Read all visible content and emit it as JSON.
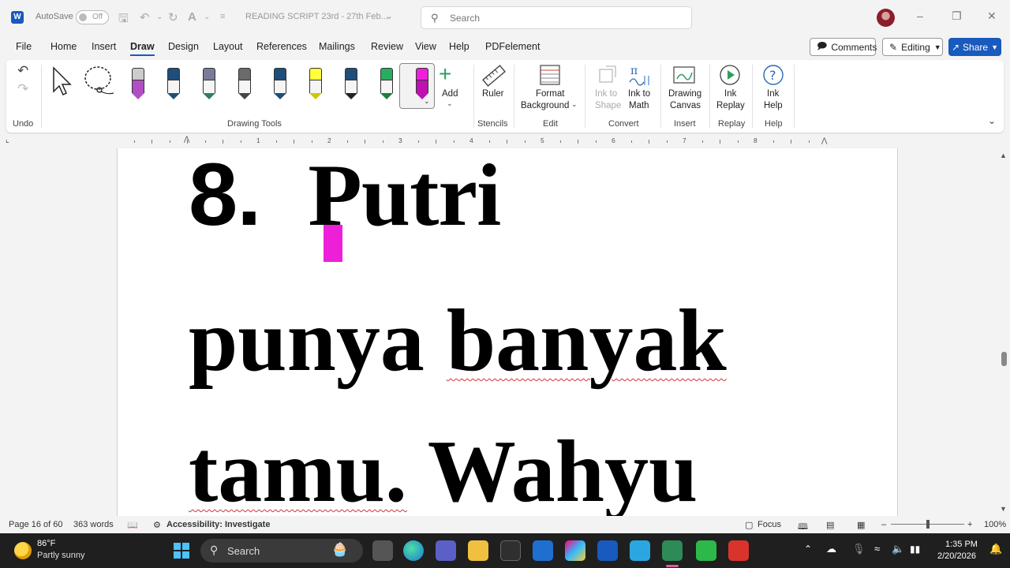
{
  "titlebar": {
    "autosave_label": "AutoSave",
    "autosave_state": "Off",
    "doc_title": "READING SCRIPT 23rd - 27th Feb...",
    "search_placeholder": "Search"
  },
  "menu": {
    "items": [
      "File",
      "Home",
      "Insert",
      "Draw",
      "Design",
      "Layout",
      "References",
      "Mailings",
      "Review",
      "View",
      "Help",
      "PDFelement"
    ],
    "active": "Draw",
    "comments_label": "Comments",
    "editing_label": "Editing",
    "share_label": "Share"
  },
  "ribbon": {
    "groups": {
      "undo": "Undo",
      "drawing_tools": "Drawing Tools",
      "stencils": "Stencils",
      "edit": "Edit",
      "convert": "Convert",
      "insert": "Insert",
      "replay": "Replay",
      "help": "Help"
    },
    "add_label": "Add",
    "ruler_label": "Ruler",
    "format_background_label_1": "Format",
    "format_background_label_2": "Background",
    "ink_to_shape_1": "Ink to",
    "ink_to_shape_2": "Shape",
    "ink_to_math_1": "Ink to",
    "ink_to_math_2": "Math",
    "drawing_canvas_1": "Drawing",
    "drawing_canvas_2": "Canvas",
    "ink_replay_1": "Ink",
    "ink_replay_2": "Replay",
    "ink_help_1": "Ink",
    "ink_help_2": "Help",
    "pens": [
      {
        "cap": "#cccccc",
        "tip": "#b04fc4"
      },
      {
        "cap": "#1f4e79",
        "tip": "#1f4e79"
      },
      {
        "cap": "#7a7a9a",
        "tip": "#2e7d6b"
      },
      {
        "cap": "#6b6b6b",
        "tip": "#444444"
      },
      {
        "cap": "#1f4e79",
        "tip": "#1f4e79"
      },
      {
        "cap": "#ffff3c",
        "tip": "#d4c400"
      },
      {
        "cap": "#1f4e79",
        "tip": "#222222"
      },
      {
        "cap": "#27ae60",
        "tip": "#1e7d3a"
      },
      {
        "cap": "#ee1fd9",
        "tip": "#c010b0"
      }
    ]
  },
  "ruler": {
    "numbers": [
      "1",
      "2",
      "3",
      "4",
      "5",
      "6",
      "7",
      "8"
    ]
  },
  "document": {
    "line1_num": "8.",
    "line1_word": "Putri",
    "line2_a": "punya",
    "line2_b": "banyak",
    "line3_a": "tamu.",
    "line3_b": "Wahyu"
  },
  "status": {
    "page": "Page 16 of 60",
    "words": "363 words",
    "accessibility": "Accessibility: Investigate",
    "focus": "Focus",
    "zoom": "100%"
  },
  "taskbar": {
    "weather_temp": "86°F",
    "weather_desc": "Partly sunny",
    "search_label": "Search",
    "time": "1:35 PM",
    "date": "2/20/2026"
  }
}
